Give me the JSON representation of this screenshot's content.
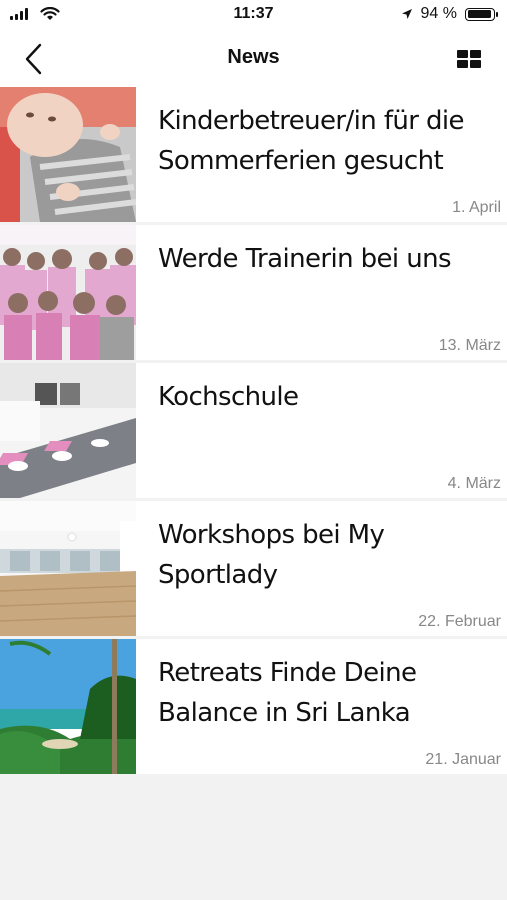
{
  "status": {
    "time": "11:37",
    "battery": "94 %",
    "battery_level": 0.94
  },
  "nav": {
    "title": "News"
  },
  "news": [
    {
      "title": "Kinderbetreuer/in für die Sommerferien gesucht",
      "date": "1. April"
    },
    {
      "title": "Werde Trainerin bei uns",
      "date": "13. März"
    },
    {
      "title": "Kochschule",
      "date": "4. März"
    },
    {
      "title": "Workshops bei My Sportlady",
      "date": "22. Februar"
    },
    {
      "title": "Retreats Finde Deine Balance in Sri Lanka",
      "date": "21. Januar"
    }
  ]
}
